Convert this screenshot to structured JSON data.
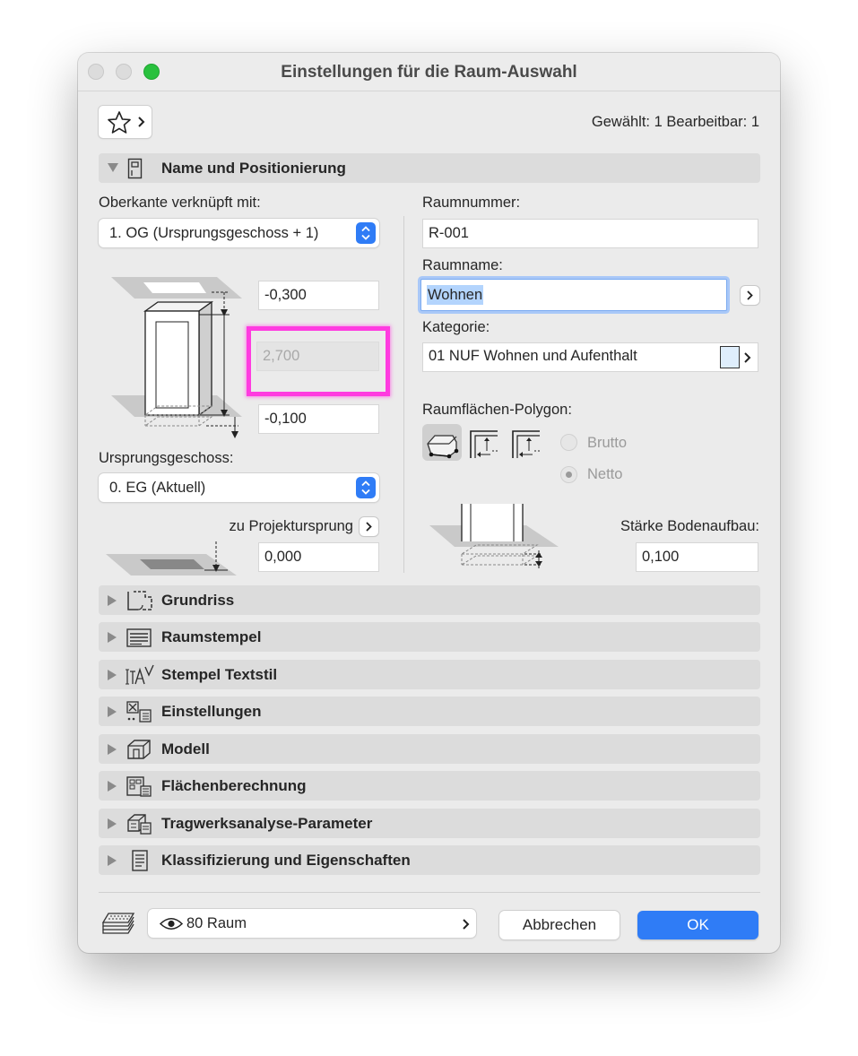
{
  "window": {
    "title": "Einstellungen für die Raum-Auswahl"
  },
  "header": {
    "selection_info": "Gewählt: 1 Bearbeitbar: 1"
  },
  "name_section": {
    "title": "Name und Positionierung",
    "top_link_label": "Oberkante verknüpft mit:",
    "top_link_value": "1. OG (Ursprungsgeschoss + 1)",
    "top_offset": "-0,300",
    "height": "2,700",
    "bottom_offset": "-0,100",
    "home_story_label": "Ursprungsgeschoss:",
    "home_story_value": "0. EG (Aktuell)",
    "project_origin_label": "zu Projektursprung",
    "project_origin_value": "0,000",
    "room_number_label": "Raumnummer:",
    "room_number": "R-001",
    "room_name_label": "Raumname:",
    "room_name": "Wohnen",
    "category_label": "Kategorie:",
    "category_value": "01 NUF Wohnen und Aufenthalt",
    "polygon_label": "Raumflächen-Polygon:",
    "radio_gross": "Brutto",
    "radio_net": "Netto",
    "floor_thickness_label": "Stärke Bodenaufbau:",
    "floor_thickness": "0,100"
  },
  "sections": [
    {
      "title": "Grundriss",
      "icon": "floor-plan-icon"
    },
    {
      "title": "Raumstempel",
      "icon": "zone-stamp-icon"
    },
    {
      "title": "Stempel Textstil",
      "icon": "text-style-icon"
    },
    {
      "title": "Einstellungen",
      "icon": "settings-icon"
    },
    {
      "title": "Modell",
      "icon": "model-icon"
    },
    {
      "title": "Flächenberechnung",
      "icon": "area-calculation-icon"
    },
    {
      "title": "Tragwerksanalyse-Parameter",
      "icon": "structural-analysis-icon"
    },
    {
      "title": "Klassifizierung und Eigenschaften",
      "icon": "classification-icon"
    }
  ],
  "footer": {
    "layer_value": "80 Raum",
    "cancel_label": "Abbrechen",
    "ok_label": "OK"
  },
  "colors": {
    "accent": "#2f7cf6",
    "highlight": "#ff3be0",
    "selection": "#b3d4fd"
  }
}
